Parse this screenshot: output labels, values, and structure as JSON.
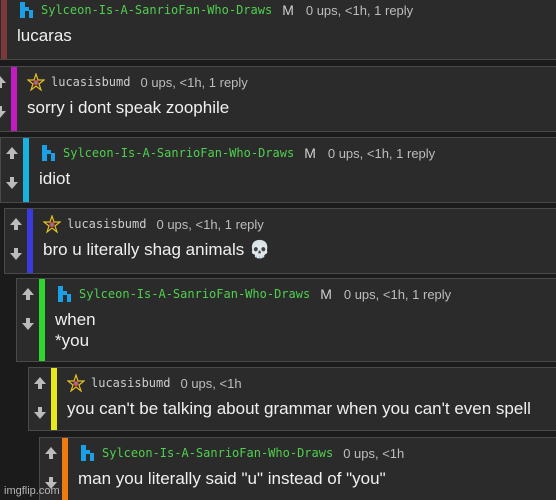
{
  "colors": {
    "background": "#1b1b1b",
    "card": "#2b2b2b",
    "username_green": "#4fcf4f",
    "username_gray": "#cccccc",
    "arrow": "#bbbbbb"
  },
  "comments": [
    {
      "username": "Sylceon-Is-A-SanrioFan-Who-Draws",
      "avatar_icon": "blue-figure-icon",
      "badge": "M",
      "stats": "0 ups, <1h, 1 reply",
      "body": "lucaras",
      "accent_color": "#7a3a3a"
    },
    {
      "username": "lucasisbumd",
      "avatar_icon": "rainbow-star-icon",
      "badge": "",
      "stats": "0 ups, <1h, 1 reply",
      "body": "sorry i dont speak zoophile",
      "accent_color": "#c21bc2"
    },
    {
      "username": "Sylceon-Is-A-SanrioFan-Who-Draws",
      "avatar_icon": "blue-figure-icon",
      "badge": "M",
      "stats": "0 ups, <1h, 1 reply",
      "body": "idiot",
      "accent_color": "#1ab0e0"
    },
    {
      "username": "lucasisbumd",
      "avatar_icon": "rainbow-star-icon",
      "badge": "",
      "stats": "0 ups, <1h, 1 reply",
      "body": "bro u literally shag animals 💀",
      "accent_color": "#3a3ae0"
    },
    {
      "username": "Sylceon-Is-A-SanrioFan-Who-Draws",
      "avatar_icon": "blue-figure-icon",
      "badge": "M",
      "stats": "0 ups, <1h, 1 reply",
      "body": "when\n*you",
      "accent_color": "#2fd62f"
    },
    {
      "username": "lucasisbumd",
      "avatar_icon": "rainbow-star-icon",
      "badge": "",
      "stats": "0 ups, <1h",
      "body": "you can't be talking about grammar when you can't even spell",
      "accent_color": "#e8e81a"
    },
    {
      "username": "Sylceon-Is-A-SanrioFan-Who-Draws",
      "avatar_icon": "blue-figure-icon",
      "badge": "",
      "stats": "0 ups, <1h",
      "body": "man you literally said \"u\" instead of \"you\"",
      "accent_color": "#f07a10"
    }
  ],
  "watermark": "imgflip.com"
}
